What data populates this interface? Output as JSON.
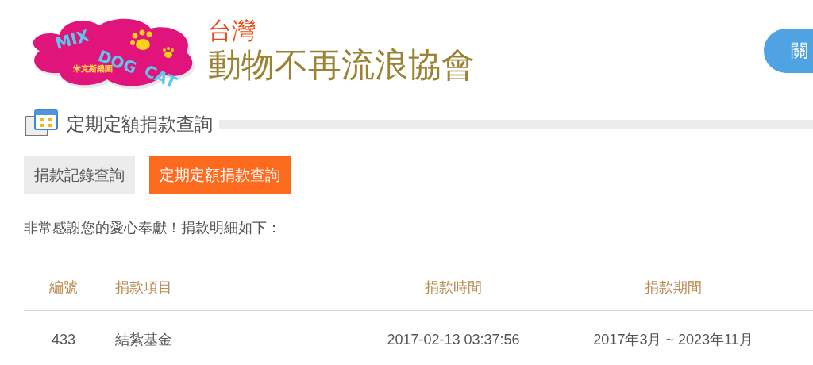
{
  "logo": {
    "words": [
      "MIX",
      "DOG",
      "CAT"
    ],
    "caption": "米克斯樂園"
  },
  "org": {
    "region": "台灣",
    "name": "動物不再流浪協會"
  },
  "header_button": {
    "label": "關"
  },
  "section": {
    "title": "定期定額捐款查詢"
  },
  "tabs": [
    {
      "label": "捐款記錄查詢",
      "selected": false
    },
    {
      "label": "定期定額捐款查詢",
      "selected": true
    }
  ],
  "message": "非常感謝您的愛心奉獻！捐款明細如下：",
  "table": {
    "columns": [
      "編號",
      "捐款項目",
      "捐款時間",
      "捐款期間"
    ],
    "rows": [
      [
        "433",
        "結紮基金",
        "2017-02-13 03:37:56",
        "2017年3月 ~ 2023年11月"
      ]
    ]
  }
}
